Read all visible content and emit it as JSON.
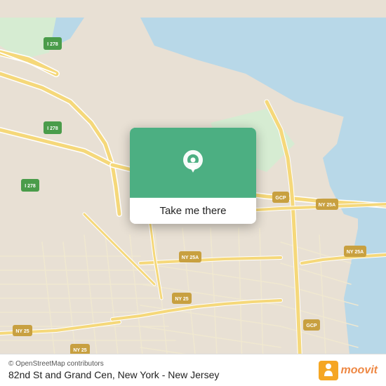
{
  "map": {
    "attribution": "© OpenStreetMap contributors",
    "location": "82nd St and Grand Cen, New York - New Jersey",
    "card_button_label": "Take me there",
    "moovit_logo": "moovit"
  },
  "roads": {
    "i278_label": "I 278",
    "ny25_label": "NY 25",
    "ny25a_label": "NY 25A",
    "gcp_label": "GCP"
  }
}
